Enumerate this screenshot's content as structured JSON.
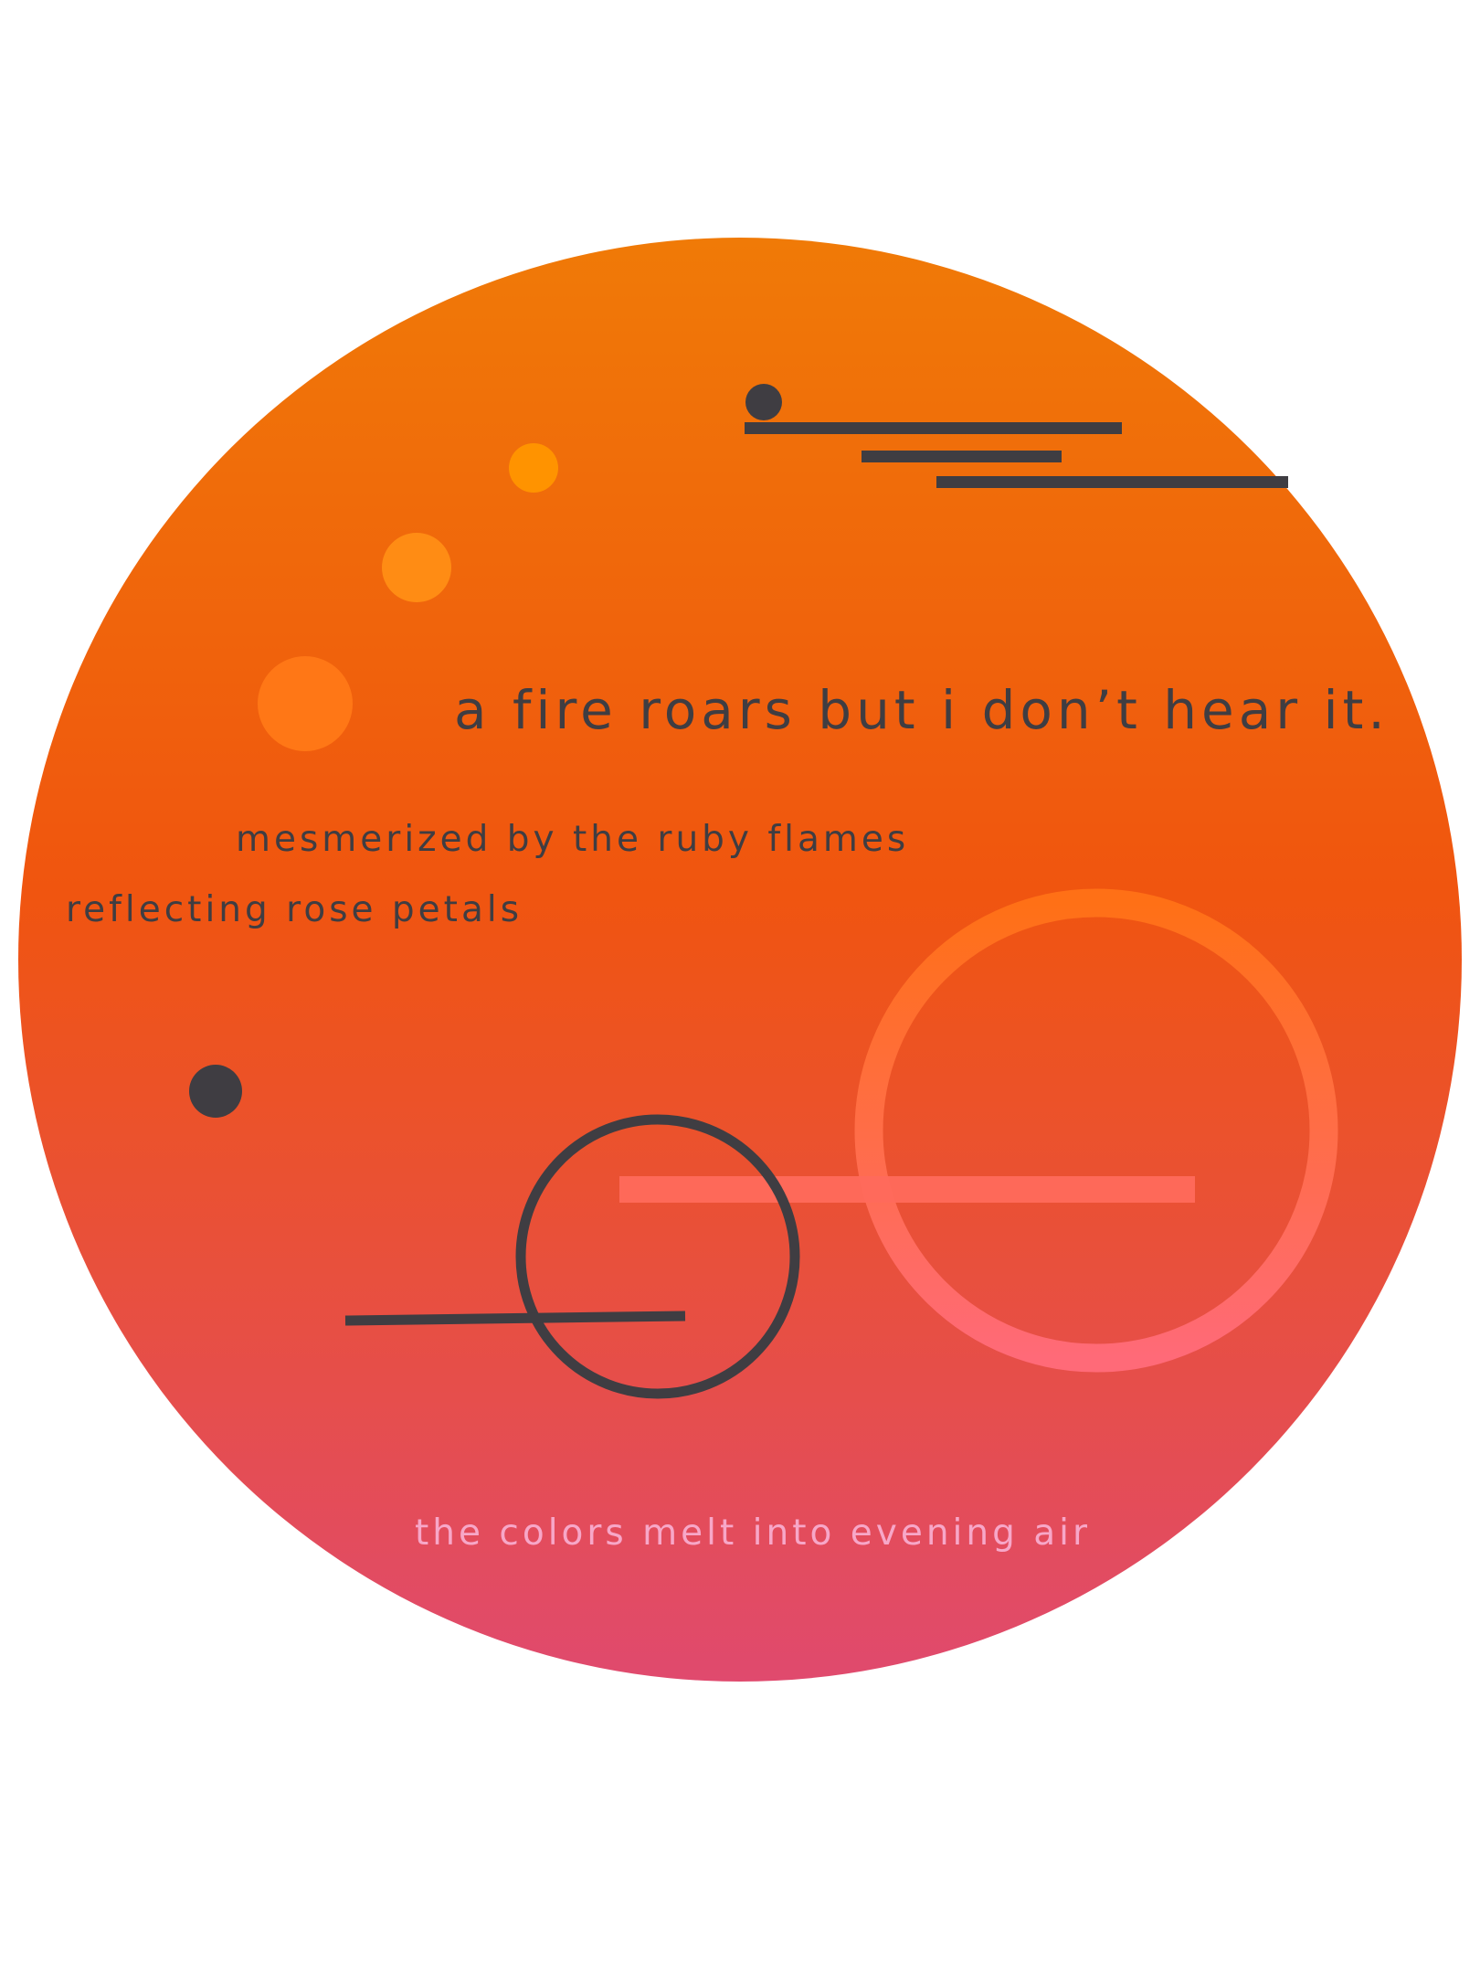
{
  "poem": {
    "headline": "a fire roars but i don’t hear it.",
    "line_1": "mesmerized by the ruby flames",
    "line_2": "reflecting rose petals",
    "closing": "the colors melt into evening air"
  },
  "colors": {
    "background": "#ffffff",
    "gradient_top": "#f07a07",
    "gradient_middle": "#f0550f",
    "gradient_bottom": "#e04a6e",
    "dark_ink": "#3f3d42",
    "closing_text": "#f7a7c8",
    "small_dot": "#ff9300",
    "medium_dot": "#ff8c14",
    "large_dot": "#ff7716",
    "ring_top": "#ff7016",
    "ring_bottom": "#ff6a78",
    "bar_color": "#ff6a5c"
  }
}
